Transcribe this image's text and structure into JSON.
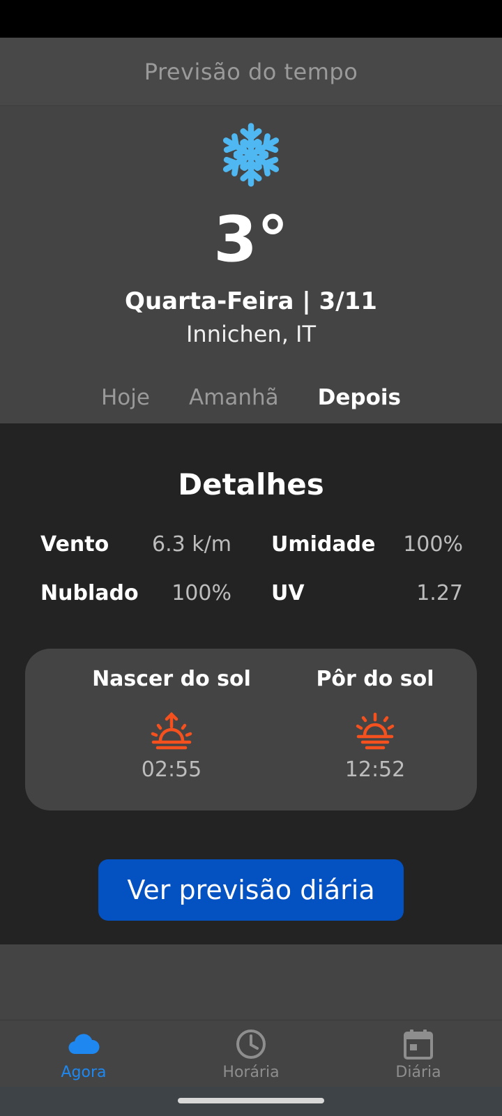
{
  "app_bar": {
    "title": "Previsão do tempo"
  },
  "current": {
    "icon": "snowflake-icon",
    "icon_color": "#4fb8f2",
    "temperature": "3°",
    "date": "Quarta-Feira | 3/11",
    "location": "Innichen, IT"
  },
  "tabs": [
    {
      "label": "Hoje",
      "active": false
    },
    {
      "label": "Amanhã",
      "active": false
    },
    {
      "label": "Depois",
      "active": true
    }
  ],
  "details": {
    "title": "Detalhes",
    "wind": {
      "label": "Vento",
      "value": "6.3 k/m"
    },
    "humidity": {
      "label": "Umidade",
      "value": "100%"
    },
    "cloudiness": {
      "label": "Nublado",
      "value": "100%"
    },
    "uv": {
      "label": "UV",
      "value": "1.27"
    }
  },
  "sun": {
    "icon_color": "#f4511e",
    "sunrise": {
      "label": "Nascer do sol",
      "time": "02:55",
      "icon": "sunrise-icon"
    },
    "sunset": {
      "label": "Pôr do sol",
      "time": "12:52",
      "icon": "sunset-icon"
    }
  },
  "cta": {
    "label": "Ver previsão diária",
    "color": "#0451c2"
  },
  "bottom_nav": [
    {
      "label": "Agora",
      "icon": "cloud-icon",
      "active": true
    },
    {
      "label": "Horária",
      "icon": "clock-icon",
      "active": false
    },
    {
      "label": "Diária",
      "icon": "calendar-icon",
      "active": false
    }
  ],
  "colors": {
    "active_nav": "#1e88f0",
    "inactive": "#8e8e8e",
    "details_bg": "#232323",
    "surface": "#444444"
  }
}
